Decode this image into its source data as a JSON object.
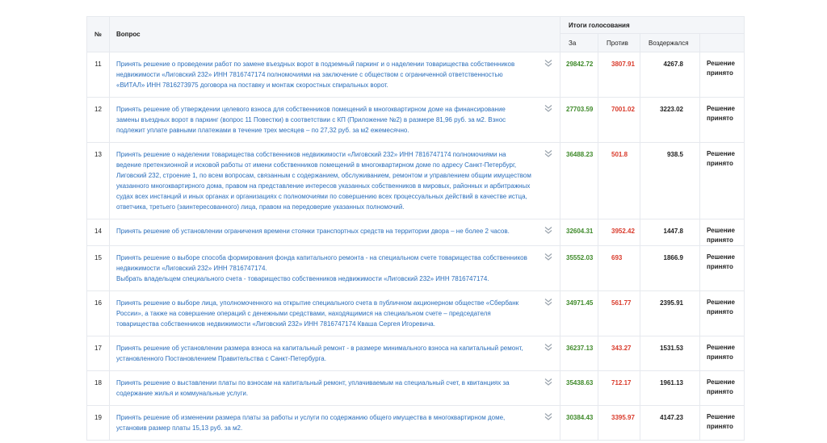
{
  "header": {
    "num_label": "№",
    "question_label": "Вопрос",
    "results_label": "Итоги голосования",
    "za_label": "За",
    "protiv_label": "Против",
    "vozd_label": "Воздержался"
  },
  "rows": [
    {
      "num": "11",
      "lines": [
        "Принять решение о проведении работ по замене въездных ворот в подземный паркинг и о наделении товарищества собственников",
        "недвижимости «Лиговский 232» ИНН 7816747174 полномочиями на заключение с обществом с ограниченной ответственностью",
        "«ВИТАЛ» ИНН 7816273975 договора на поставку и монтаж скоростных спиральных ворот."
      ],
      "za": "29842.72",
      "protiv": "3807.91",
      "vozd": "4267.8",
      "result1": "Решение",
      "result2": "принято"
    },
    {
      "num": "12",
      "lines": [
        "Принять решение об утверждении целевого взноса для собственников помещений в многоквартирном доме на финансирование",
        "замены въездных ворот в паркинг (вопрос 11 Повестки) в соответствии с КП (Приложение №2) в размере 81,96 руб. за м2. Взнос",
        "подлежит уплате равными платежами в течение трех месяцев – по  27,32 руб. за м2 ежемесячно."
      ],
      "za": "27703.59",
      "protiv": "7001.02",
      "vozd": "3223.02",
      "result1": "Решение",
      "result2": "принято"
    },
    {
      "num": "13",
      "lines": [
        "Принять решение о наделении товарищества собственников недвижимости «Лиговский 232» ИНН 7816747174 полномочиями на",
        "ведение претензионной и исковой работы от имени собственников помещений в многоквартирном доме по адресу Санкт-Петербург,",
        "Лиговский 232, строение 1, по всем вопросам, связанным с содержанием, обслуживанием, ремонтом и управлением общим имуществом",
        "указанного многоквартирного дома, правом на представление интересов указанных собственников в мировых, районных и арбитражных",
        "судах всех инстанций и иных органах и организациях с полномочиями по совершению всех процессуальных действий в качестве истца,",
        "ответчика, третьего (заинтересованного) лица, правом на передоверие указанных полномочий."
      ],
      "za": "36488.23",
      "protiv": "501.8",
      "vozd": "938.5",
      "result1": "Решение",
      "result2": "принято"
    },
    {
      "num": "14",
      "lines": [
        "Принять решение об установлении ограничения времени стоянки транспортных средств на территории двора – не более 2 часов."
      ],
      "za": "32604.31",
      "protiv": "3952.42",
      "vozd": "1447.8",
      "result1": "Решение",
      "result2": "принято"
    },
    {
      "num": "15",
      "lines": [
        "Принять решение о выборе способа формирования фонда капитального ремонта - на специальном счете товарищества собственников",
        "недвижимости «Лиговский 232» ИНН 7816747174.",
        "Выбрать владельцем специального счета - товарищество собственников недвижимости «Лиговский 232» ИНН 7816747174."
      ],
      "za": "35552.03",
      "protiv": "693",
      "vozd": "1866.9",
      "result1": "Решение",
      "result2": "принято"
    },
    {
      "num": "16",
      "lines": [
        "Принять решение о выборе лица, уполномоченного на открытие специального счета в публичном акционерном обществе «Сбербанк",
        "России», а также на совершение операций с денежными средствами, находящимися на специальном счете – председателя",
        "товарищества собственников недвижимости «Лиговский 232» ИНН 7816747174 Кваша Сергея Игоревича."
      ],
      "za": "34971.45",
      "protiv": "561.77",
      "vozd": "2395.91",
      "result1": "Решение",
      "result2": "принято"
    },
    {
      "num": "17",
      "lines": [
        "Принять решение об установлении размера взноса на капитальный ремонт - в размере минимального взноса на капитальный ремонт,",
        "установленного Постановлением Правительства с Санкт-Петербурга."
      ],
      "za": "36237.13",
      "protiv": "343.27",
      "vozd": "1531.53",
      "result1": "Решение",
      "result2": "принято"
    },
    {
      "num": "18",
      "lines": [
        "Принять решение о выставлении платы по взносам на капитальный ремонт, уплачиваемым на специальный счет, в квитанциях за",
        "содержание жилья и коммунальные услуги."
      ],
      "za": "35438.63",
      "protiv": "712.17",
      "vozd": "1961.13",
      "result1": "Решение",
      "result2": "принято"
    },
    {
      "num": "19",
      "lines": [
        "Принять решение об изменении размера платы за работы и услуги по содержанию общего имущества в многоквартирном доме,",
        "установив размер платы 15,13 руб. за м2."
      ],
      "za": "30384.43",
      "protiv": "3395.97",
      "vozd": "4147.23",
      "result1": "Решение",
      "result2": "принято"
    }
  ],
  "icons": {
    "expand": "chevron-double-down-icon"
  },
  "colors": {
    "link": "#2a6ebb",
    "za": "#3f8a2a",
    "protiv": "#d93a2b",
    "header_bg": "#f4f6f9"
  }
}
